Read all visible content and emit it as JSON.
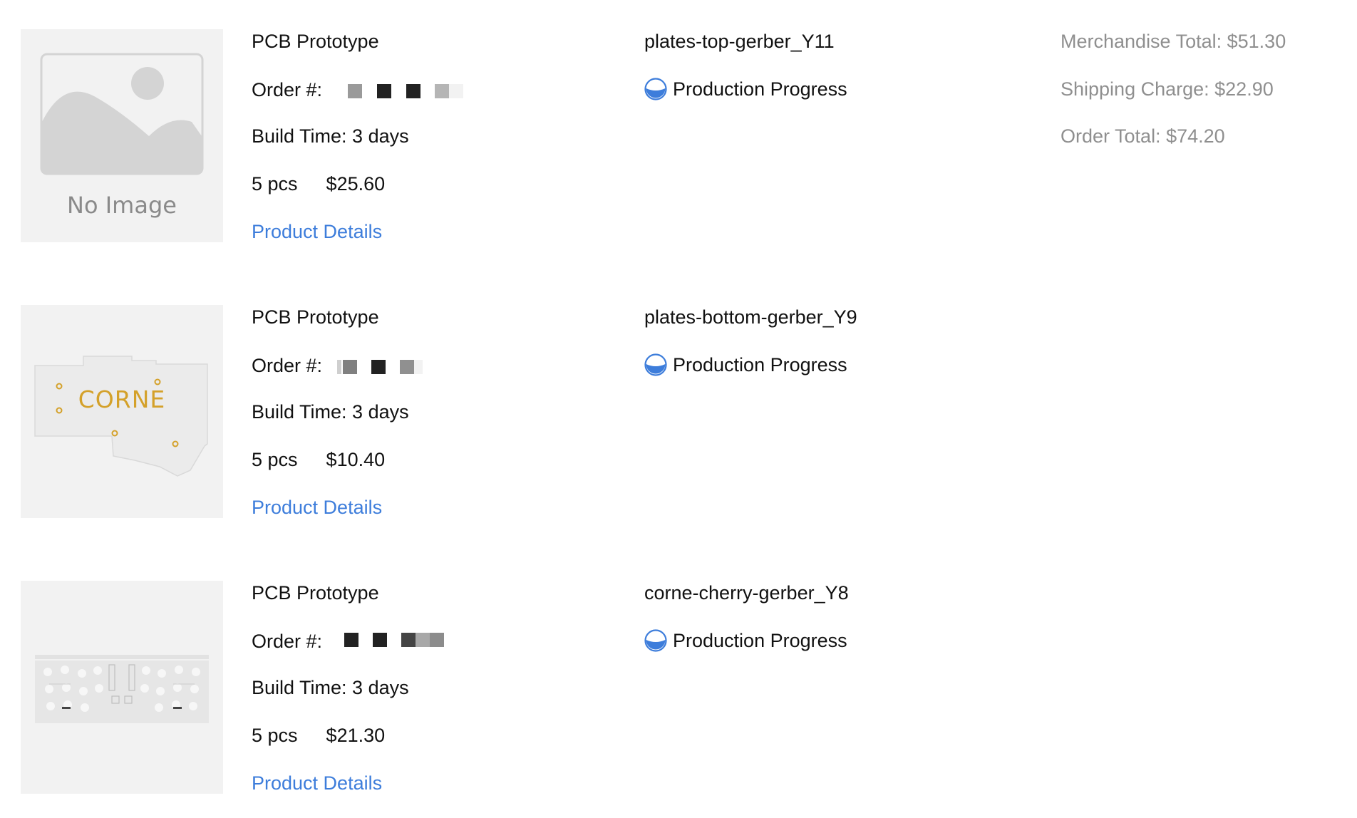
{
  "orders": [
    {
      "thumbnail": "no-image",
      "thumbnail_text": "No Image",
      "product_type": "PCB Prototype",
      "order_label": "Order #:",
      "build_time": "Build Time: 3 days",
      "quantity": "5 pcs",
      "price": "$25.60",
      "details_link": "Product Details",
      "file_name": "plates-top-gerber_Y11",
      "status": "Production Progress",
      "status_icon": "progress-half-circle-icon"
    },
    {
      "thumbnail": "corne-plate-preview",
      "thumbnail_text": "CORNE",
      "product_type": "PCB Prototype",
      "order_label": "Order #:",
      "build_time": "Build Time: 3 days",
      "quantity": "5 pcs",
      "price": "$10.40",
      "details_link": "Product Details",
      "file_name": "plates-bottom-gerber_Y9",
      "status": "Production Progress",
      "status_icon": "progress-half-circle-icon"
    },
    {
      "thumbnail": "corne-cherry-board-preview",
      "product_type": "PCB Prototype",
      "order_label": "Order #:",
      "build_time": "Build Time: 3 days",
      "quantity": "5 pcs",
      "price": "$21.30",
      "details_link": "Product Details",
      "file_name": "corne-cherry-gerber_Y8",
      "status": "Production Progress",
      "status_icon": "progress-half-circle-icon"
    }
  ],
  "totals": {
    "merchandise": "Merchandise Total: $51.30",
    "shipping": "Shipping Charge: $22.90",
    "order": "Order Total: $74.20"
  },
  "colors": {
    "link": "#3d7ddb",
    "status_icon": "#3d7ddb",
    "muted_text": "#8f8f8f",
    "thumb_bg": "#f2f2f2",
    "corne_gold": "#d4a12a"
  }
}
